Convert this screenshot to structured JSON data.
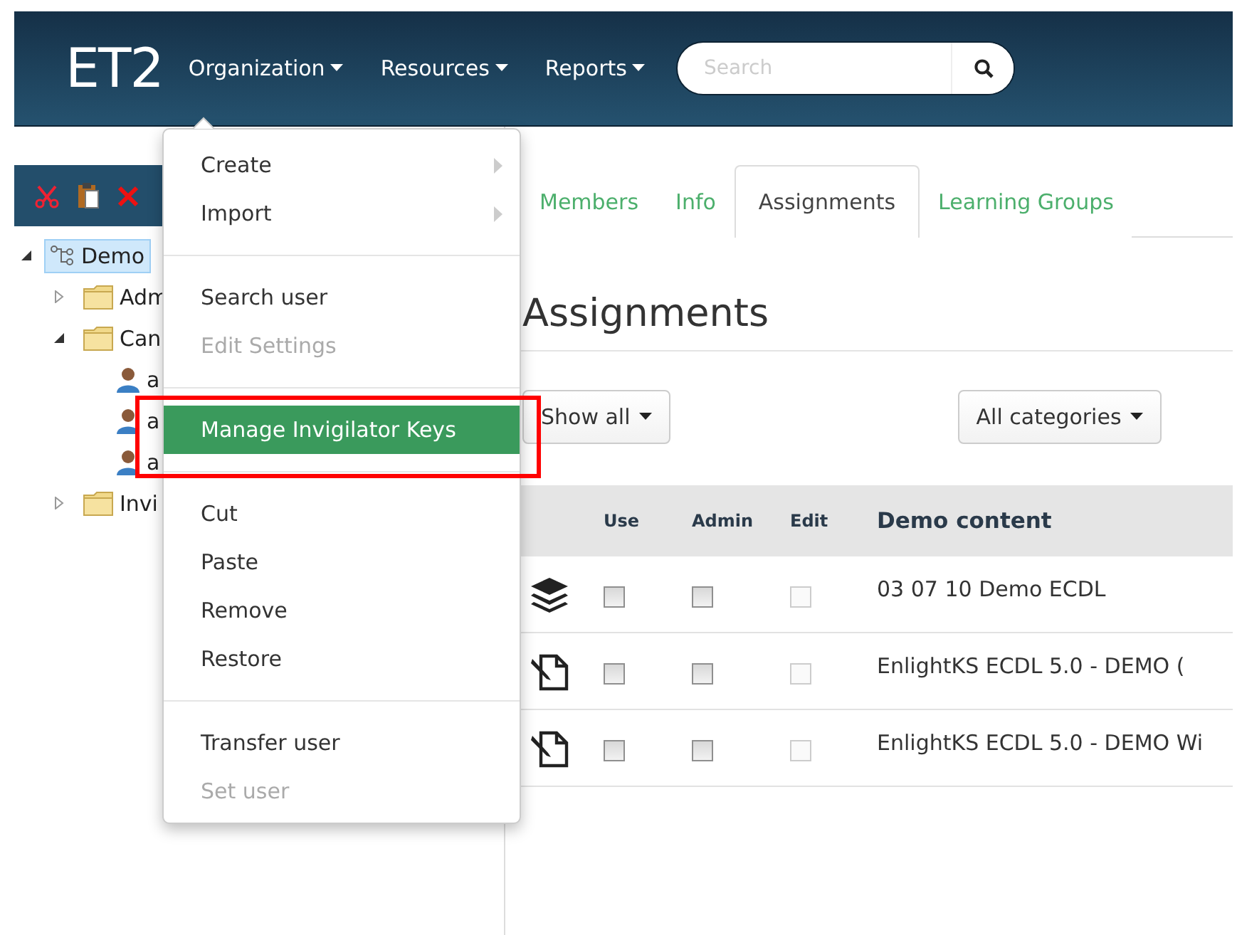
{
  "navbar": {
    "logo": "ET2",
    "menus": [
      {
        "label": "Organization"
      },
      {
        "label": "Resources"
      },
      {
        "label": "Reports"
      }
    ],
    "search": {
      "placeholder": "Search"
    }
  },
  "toolbar": {
    "tools": [
      {
        "kind": "cut"
      },
      {
        "kind": "paste"
      },
      {
        "kind": "delete"
      }
    ]
  },
  "tree": [
    {
      "label": "Demo",
      "kind": "org",
      "expanded": true,
      "selected": true,
      "children": [
        {
          "label": "Adm",
          "kind": "folder",
          "expanded": false,
          "selected": false
        },
        {
          "label": "Can",
          "kind": "folder",
          "expanded": true,
          "selected": false,
          "children": [
            {
              "label": "a",
              "kind": "user",
              "selected": false
            },
            {
              "label": "a",
              "kind": "user",
              "selected": false
            },
            {
              "label": "a",
              "kind": "user",
              "selected": false
            }
          ]
        },
        {
          "label": "Invi",
          "kind": "folder",
          "expanded": false,
          "selected": false
        }
      ]
    }
  ],
  "dropdown": {
    "groups": [
      [
        {
          "label": "Create",
          "submenu": true,
          "disabled": false,
          "active": false,
          "highlighted": false
        },
        {
          "label": "Import",
          "submenu": true,
          "disabled": false,
          "active": false,
          "highlighted": false
        }
      ],
      [
        {
          "label": "Search user",
          "submenu": false,
          "disabled": false,
          "active": false,
          "highlighted": false
        },
        {
          "label": "Edit Settings",
          "submenu": false,
          "disabled": true,
          "active": false,
          "highlighted": false
        }
      ],
      [
        {
          "label": "Manage Invigilator Keys",
          "submenu": false,
          "disabled": false,
          "active": true,
          "highlighted": true
        }
      ],
      [
        {
          "label": "Cut",
          "submenu": false,
          "disabled": false,
          "active": false,
          "highlighted": false
        },
        {
          "label": "Paste",
          "submenu": false,
          "disabled": false,
          "active": false,
          "highlighted": false
        },
        {
          "label": "Remove",
          "submenu": false,
          "disabled": false,
          "active": false,
          "highlighted": false
        },
        {
          "label": "Restore",
          "submenu": false,
          "disabled": false,
          "active": false,
          "highlighted": false
        }
      ],
      [
        {
          "label": "Transfer user",
          "submenu": false,
          "disabled": false,
          "active": false,
          "highlighted": false
        },
        {
          "label": "Set user",
          "submenu": false,
          "disabled": true,
          "active": false,
          "highlighted": false
        }
      ]
    ]
  },
  "tabs": [
    {
      "label": "Members",
      "selected": false
    },
    {
      "label": "Info",
      "selected": false
    },
    {
      "label": "Assignments",
      "selected": true
    },
    {
      "label": "Learning Groups",
      "selected": false
    }
  ],
  "heading": "Assignments",
  "filters": [
    {
      "label": "Show all"
    },
    {
      "label": "All categories"
    }
  ],
  "table": {
    "columns": [
      "Use",
      "Admin",
      "Edit",
      "Demo content"
    ],
    "rows": [
      {
        "kind": "stack",
        "use": {
          "checked": false,
          "disabled": false
        },
        "admin": {
          "checked": false,
          "disabled": false
        },
        "edit": {
          "checked": false,
          "disabled": true
        },
        "name": "03 07 10 Demo ECDL"
      },
      {
        "kind": "document",
        "use": {
          "checked": false,
          "disabled": false
        },
        "admin": {
          "checked": false,
          "disabled": false
        },
        "edit": {
          "checked": false,
          "disabled": true
        },
        "name": "EnlightKS ECDL 5.0 - DEMO ("
      },
      {
        "kind": "document",
        "use": {
          "checked": false,
          "disabled": false
        },
        "admin": {
          "checked": false,
          "disabled": false
        },
        "edit": {
          "checked": false,
          "disabled": true
        },
        "name": "EnlightKS ECDL 5.0 - DEMO Wi"
      }
    ]
  }
}
